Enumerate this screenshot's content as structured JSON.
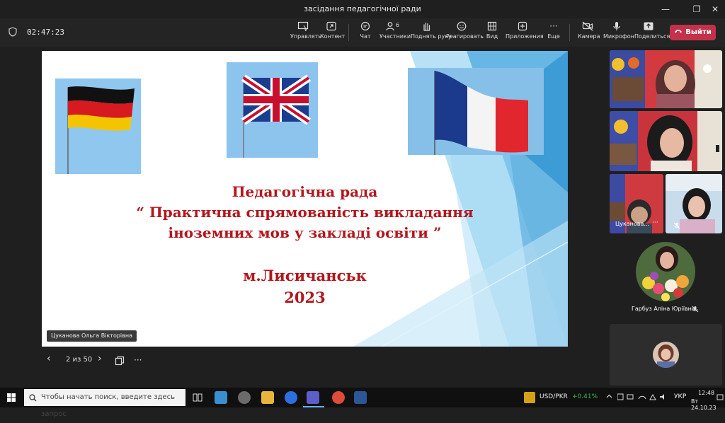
{
  "window": {
    "title": "засідання педагогічної ради",
    "minimize": "—",
    "restore": "❐",
    "close": "✕"
  },
  "toolbar": {
    "timer": "02:47:23",
    "items": [
      {
        "label": "Управлять"
      },
      {
        "label": "Контент"
      },
      {
        "label": "Чат"
      },
      {
        "label": "Участники",
        "badge": "6"
      },
      {
        "label": "Поднять руку"
      },
      {
        "label": "Реагировать"
      },
      {
        "label": "Вид"
      },
      {
        "label": "Приложения"
      },
      {
        "label": "Еще",
        "glyph": "···"
      },
      {
        "label": "Камера"
      },
      {
        "label": "Микрофон"
      },
      {
        "label": "Поделиться"
      }
    ],
    "leave_label": "Выйти"
  },
  "slide": {
    "line1": "Педагогічна рада",
    "line2": "“ Практична спрямованість викладання",
    "line3": "іноземних мов у закладі освіти ”",
    "line4": "м.Лисичанськ",
    "line5": "2023"
  },
  "presenter_name": "Цуканова Ольга Вікторівна",
  "pager": {
    "page_text": "2 из 50",
    "prev": "‹",
    "next": "›",
    "more": "···"
  },
  "participants": {
    "tile3_name": "Цуканова...",
    "tile3_more": "···",
    "tile4_name": "Гарбуз Аліна Юріївна"
  },
  "taskbar": {
    "search_placeholder": "Чтобы начать поиск, введите здесь запрос",
    "ticker_symbol": "USD/PKR",
    "ticker_change": "+0.41%",
    "lang": "УКР",
    "time": "12:48",
    "date": "Вт 24.10.23"
  },
  "colors": {
    "leave_red": "#c4314b",
    "slide_text": "#b3161d",
    "ticker_green": "#3fb950"
  }
}
